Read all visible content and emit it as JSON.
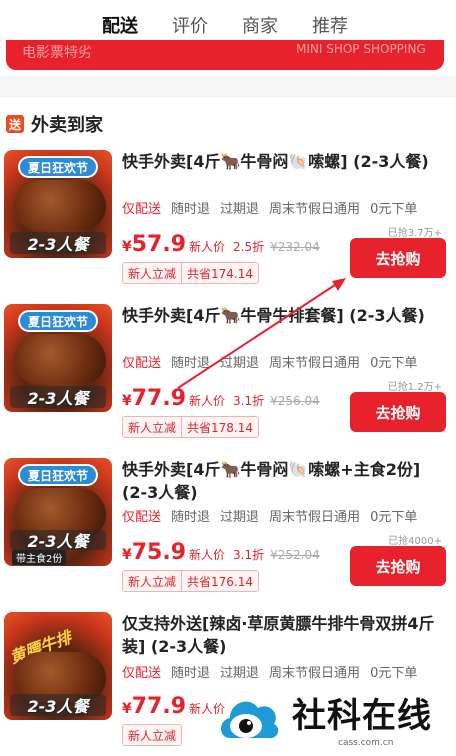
{
  "tabs": [
    "配送",
    "评价",
    "商家",
    "推荐"
  ],
  "banner": {
    "left_text": "电影票特劣",
    "right_text": "MINI SHOP SHOPPING"
  },
  "section": {
    "badge": "送",
    "title": "外卖到家"
  },
  "cards": [
    {
      "ribbon": "夏日狂欢节",
      "portion": "2-3人餐",
      "extra": "",
      "title": "快手外卖[4斤🐂牛骨闷🐚嗦螺] (2-3人餐)",
      "tags": [
        "仅配送",
        "随时退",
        "过期退",
        "周末节假日通用",
        "0元下单"
      ],
      "sold": "已抢3.7万+",
      "yen": "¥",
      "price": "57.9",
      "new_label": "新人价",
      "discount": "2.5折",
      "orig": "¥232.04",
      "promo1": "新人立减",
      "promo2": "共省174.14",
      "cta": "去抢购"
    },
    {
      "ribbon": "夏日狂欢节",
      "portion": "2-3人餐",
      "extra": "",
      "title": "快手外卖[4斤🐂牛骨牛排套餐] (2-3人餐)",
      "tags": [
        "仅配送",
        "随时退",
        "过期退",
        "周末节假日通用",
        "0元下单"
      ],
      "sold": "已抢1.2万+",
      "yen": "¥",
      "price": "77.9",
      "new_label": "新人价",
      "discount": "3.1折",
      "orig": "¥256.04",
      "promo1": "新人立减",
      "promo2": "共省178.14",
      "cta": "去抢购"
    },
    {
      "ribbon": "夏日狂欢节",
      "portion": "2-3人餐",
      "extra": "带主食2份",
      "title": "快手外卖[4斤🐂牛骨闷🐚嗦螺+主食2份] (2-3人餐)",
      "tags": [
        "仅配送",
        "随时退",
        "过期退",
        "周末节假日通用",
        "0元下单"
      ],
      "sold": "已抢4000+",
      "yen": "¥",
      "price": "75.9",
      "new_label": "新人价",
      "discount": "3.1折",
      "orig": "¥252.04",
      "promo1": "新人立减",
      "promo2": "共省176.14",
      "cta": "去抢购"
    },
    {
      "ribbon": "",
      "portion": "2-3人餐",
      "extra": "",
      "hand": "黄膘牛排",
      "title": "仅支持外送[辣卤·草原黄膘牛排牛骨双拼4斤装] (2-3人餐)",
      "tags": [
        "仅配送",
        "随时退",
        "过期退",
        "周末节假日通用",
        "0元下单"
      ],
      "sold": "",
      "yen": "¥",
      "price": "77.9",
      "new_label": "新人价",
      "discount": "",
      "orig": "",
      "promo1": "新人立减",
      "promo2": "",
      "cta": ""
    }
  ],
  "watermark": {
    "text": "社科在线",
    "url": "cass.com.cn"
  },
  "colors": {
    "accent": "#e8222c",
    "ribbon": "#2a8bd6",
    "arrow": "#e8222c"
  }
}
